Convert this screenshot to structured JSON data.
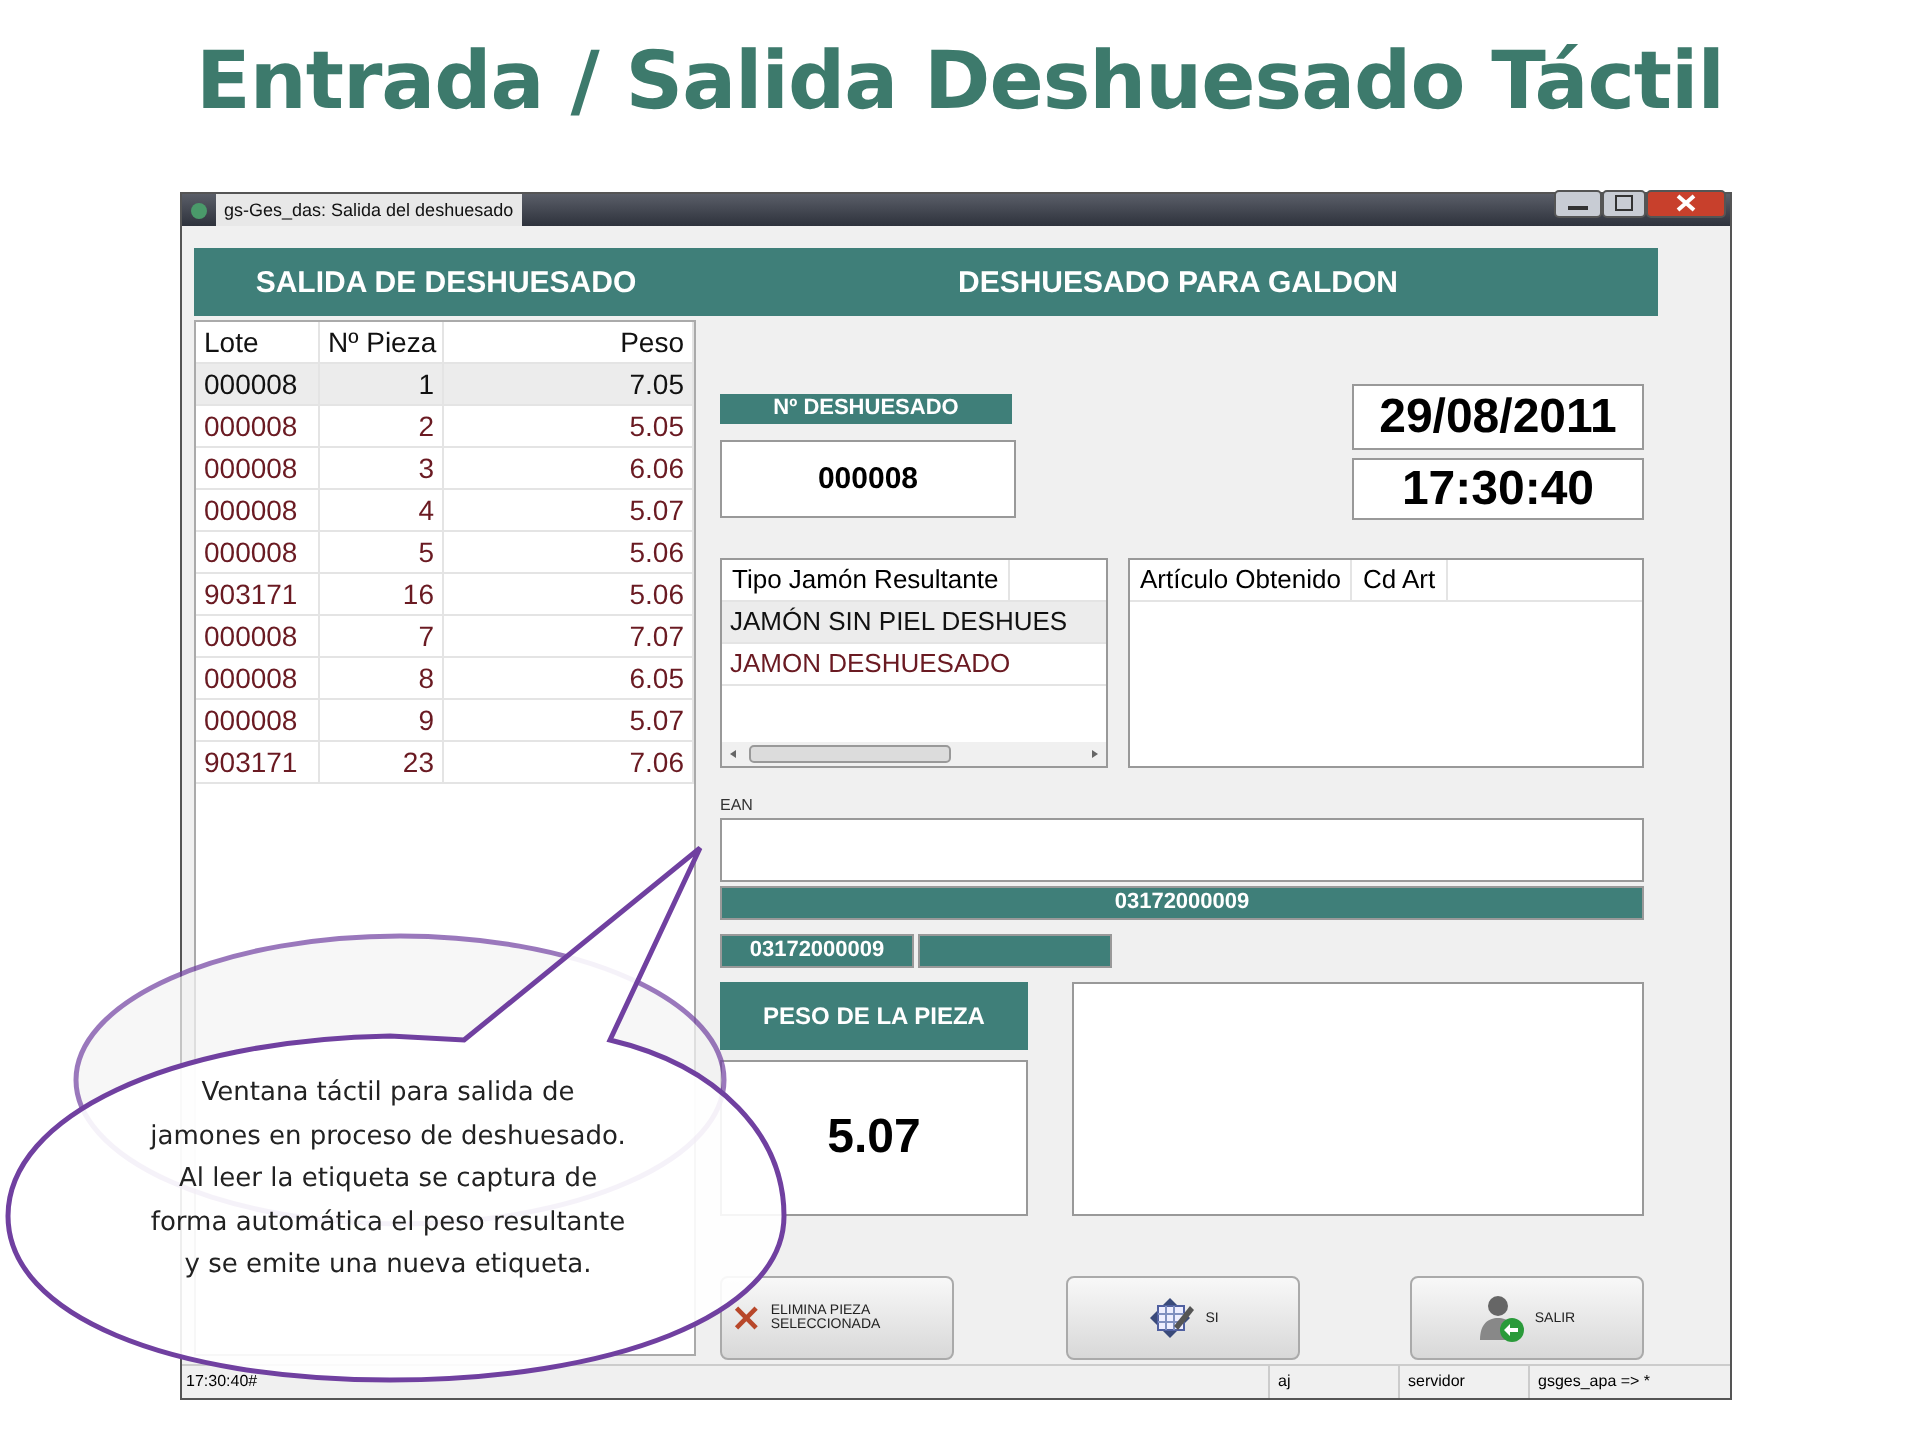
{
  "slide_title": "Entrada / Salida Deshuesado Táctil",
  "window": {
    "title": "gs-Ges_das: Salida del deshuesado"
  },
  "header": {
    "left": "SALIDA DE DESHUESADO",
    "right": "DESHUESADO PARA GALDON"
  },
  "pieces_table": {
    "columns": [
      "Lote",
      "Nº Pieza",
      "Peso"
    ],
    "rows": [
      {
        "cells": [
          "000008",
          "1",
          "7.05"
        ],
        "selected": true
      },
      {
        "cells": [
          "000008",
          "2",
          "5.05"
        ],
        "selected": false
      },
      {
        "cells": [
          "000008",
          "3",
          "6.06"
        ],
        "selected": false
      },
      {
        "cells": [
          "000008",
          "4",
          "5.07"
        ],
        "selected": false
      },
      {
        "cells": [
          "000008",
          "5",
          "5.06"
        ],
        "selected": false
      },
      {
        "cells": [
          "903171",
          "16",
          "5.06"
        ],
        "selected": false
      },
      {
        "cells": [
          "000008",
          "7",
          "7.07"
        ],
        "selected": false
      },
      {
        "cells": [
          "000008",
          "8",
          "6.05"
        ],
        "selected": false
      },
      {
        "cells": [
          "000008",
          "9",
          "5.07"
        ],
        "selected": false
      },
      {
        "cells": [
          "903171",
          "23",
          "7.06"
        ],
        "selected": false
      }
    ]
  },
  "deshuesado_number": {
    "label": "Nº DESHUESADO",
    "value": "000008"
  },
  "date": "29/08/2011",
  "time": "17:30:40",
  "ham_type_list": {
    "column": "Tipo Jamón Resultante",
    "rows": [
      {
        "label": "JAMÓN SIN PIEL DESHUES",
        "selected": true
      },
      {
        "label": "JAMON DESHUESADO",
        "selected": false
      }
    ]
  },
  "article_list": {
    "columns": [
      "Artículo Obtenido",
      "Cd Art"
    ]
  },
  "ean": {
    "label": "EAN",
    "code": "03172000009"
  },
  "code_small": "03172000009",
  "piece_weight": {
    "label": "PESO DE LA PIEZA",
    "value": "5.07"
  },
  "buttons": [
    {
      "kind": "delete",
      "label": "ELIMINA PIEZA SELECCIONADA"
    },
    {
      "kind": "edit",
      "label": "SI"
    },
    {
      "kind": "exit",
      "label": "SALIR"
    }
  ],
  "status_bar": {
    "left": "17:30:40#",
    "fields": [
      "aj",
      "servidor",
      "gsges_apa => *"
    ]
  },
  "callout": "Ventana táctil para salida de jamones en proceso de deshuesado. Al leer la etiqueta se captura de forma automática el peso resultante y se emite una nueva etiqueta."
}
